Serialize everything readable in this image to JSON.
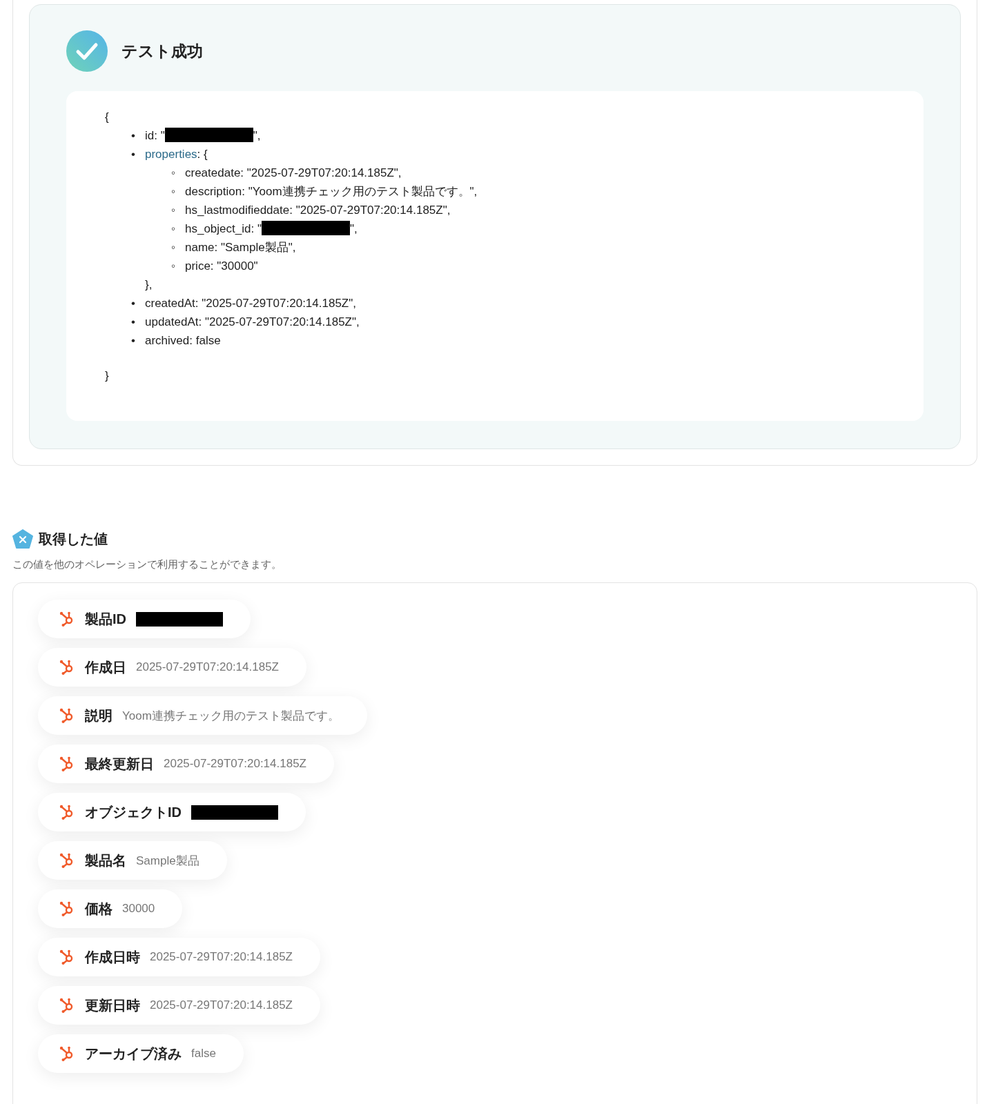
{
  "test_result": {
    "title": "テスト成功",
    "success": true,
    "code": {
      "open": "{",
      "close": "}",
      "items": [
        {
          "bullet": "•",
          "text": "id: \"",
          "redacted": true,
          "after": "\","
        },
        {
          "bullet": "•",
          "key": "properties",
          "text": ": {",
          "redacted": false,
          "close": "},",
          "children": [
            {
              "bullet": "◦",
              "text": "createdate: \"2025-07-29T07:20:14.185Z\",",
              "redacted": false
            },
            {
              "bullet": "◦",
              "text": "description: \"Yoom連携チェック用のテスト製品です。\",",
              "redacted": false
            },
            {
              "bullet": "◦",
              "text": "hs_lastmodifieddate: \"2025-07-29T07:20:14.185Z\",",
              "redacted": false
            },
            {
              "bullet": "◦",
              "text": "hs_object_id: \"",
              "redacted": true,
              "after": "\","
            },
            {
              "bullet": "◦",
              "text": "name: \"Sample製品\",",
              "redacted": false
            },
            {
              "bullet": "◦",
              "text": "price: \"30000\"",
              "redacted": false
            }
          ]
        },
        {
          "bullet": "•",
          "text": "createdAt: \"2025-07-29T07:20:14.185Z\",",
          "redacted": false
        },
        {
          "bullet": "•",
          "text": "updatedAt: \"2025-07-29T07:20:14.185Z\",",
          "redacted": false
        },
        {
          "bullet": "•",
          "text": "archived: false",
          "redacted": false
        }
      ]
    }
  },
  "values": {
    "title": "取得した値",
    "subtitle": "この値を他のオペレーションで利用することができます。",
    "items": [
      {
        "label": "製品ID",
        "redacted": true
      },
      {
        "label": "作成日",
        "value": "2025-07-29T07:20:14.185Z",
        "redacted": false
      },
      {
        "label": "説明",
        "value": "Yoom連携チェック用のテスト製品です。",
        "redacted": false
      },
      {
        "label": "最終更新日",
        "value": "2025-07-29T07:20:14.185Z",
        "redacted": false
      },
      {
        "label": "オブジェクトID",
        "redacted": true
      },
      {
        "label": "製品名",
        "value": "Sample製品",
        "redacted": false
      },
      {
        "label": "価格",
        "value": "30000",
        "redacted": false
      },
      {
        "label": "作成日時",
        "value": "2025-07-29T07:20:14.185Z",
        "redacted": false
      },
      {
        "label": "更新日時",
        "value": "2025-07-29T07:20:14.185Z",
        "redacted": false
      },
      {
        "label": "アーカイブ済み",
        "value": "false",
        "redacted": false
      }
    ]
  }
}
